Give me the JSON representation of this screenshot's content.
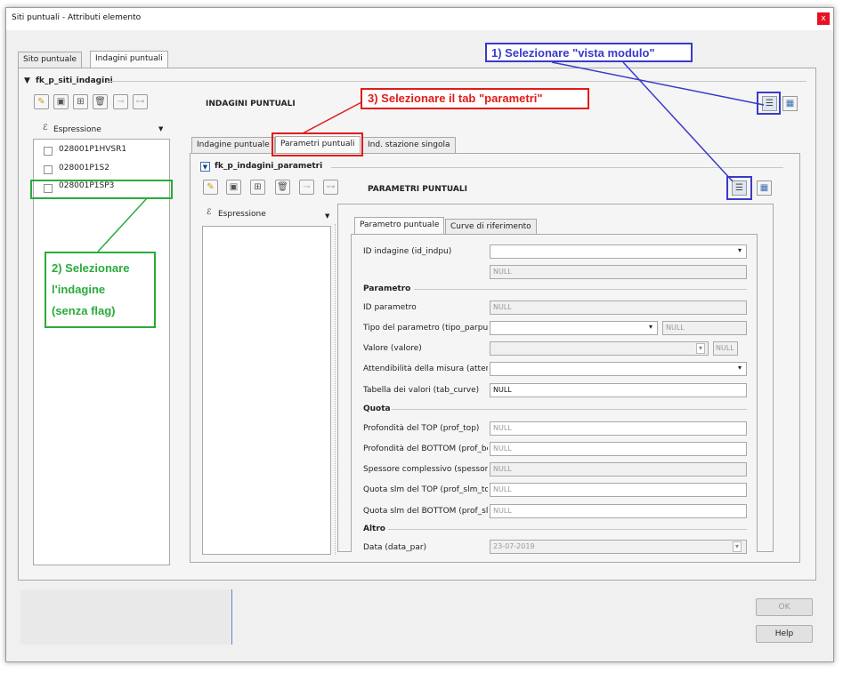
{
  "window": {
    "title": "Siti puntuali - Attributi elemento",
    "close": "x"
  },
  "top_tabs": [
    "Sito puntuale",
    "Indagini puntuali"
  ],
  "relation1": {
    "name": "fk_p_siti_indagini",
    "heading": "INDAGINI PUNTUALI",
    "expression": "Espressione",
    "list": [
      "028001P1HVSR1",
      "028001P1S2",
      "028001P1SP3"
    ],
    "tabs": [
      "Indagine puntuale",
      "Parametri puntuali",
      "Ind. stazione singola"
    ]
  },
  "relation2": {
    "name": "fk_p_indagini_parametri",
    "heading": "PARAMETRI PUNTUALI",
    "expression": "Espressione",
    "tabs": [
      "Parametro puntuale",
      "Curve di riferimento"
    ]
  },
  "form": {
    "id_indagine_label": "ID indagine (id_indpu)",
    "id_indagine_value": "NULL",
    "sec_parametro": "Parametro",
    "id_parametro_label": "ID parametro",
    "id_parametro_value": "NULL",
    "tipo_label": "Tipo del parametro (tipo_parpu)",
    "tipo_value": "NULL",
    "valore_label": "Valore (valore)",
    "valore_value": "NULL",
    "attend_label": "Attendibilità della misura (attend_",
    "tab_curve_label": "Tabella dei valori (tab_curve)",
    "tab_curve_value": "NULL",
    "sec_quota": "Quota",
    "prof_top_label": "Profondità del TOP (prof_top)",
    "prof_top_value": "NULL",
    "prof_bot_label": "Profondità del BOTTOM (prof_bot",
    "prof_bot_value": "NULL",
    "spessore_label": "Spessore complessivo (spessore)",
    "spessore_value": "NULL",
    "quota_top_label": "Quota slm del TOP (prof_slm_top",
    "quota_top_value": "NULL",
    "quota_bot_label": "Quota slm del BOTTOM (prof_slm",
    "quota_bot_value": "NULL",
    "sec_altro": "Altro",
    "data_label": "Data (data_par)",
    "data_value": "23-07-2019"
  },
  "buttons": {
    "ok": "OK",
    "help": "Help"
  },
  "annotations": {
    "a1": "1) Selezionare \"vista modulo\"",
    "a2_lines": [
      "2) Selezionare",
      "l'indagine",
      "(senza flag)"
    ],
    "a3": "3) Selezionare il tab \"parametri\""
  },
  "icons": {
    "toolbar": [
      "pencil-icon",
      "save-icon",
      "add-record-icon",
      "delete-icon",
      "link-icon",
      "unlink-icon"
    ],
    "views": [
      "form-view-icon",
      "table-view-icon"
    ]
  },
  "colors": {
    "ann_blue": "#3a3acb",
    "ann_green": "#2aab3a",
    "ann_red": "#e21b1b"
  }
}
